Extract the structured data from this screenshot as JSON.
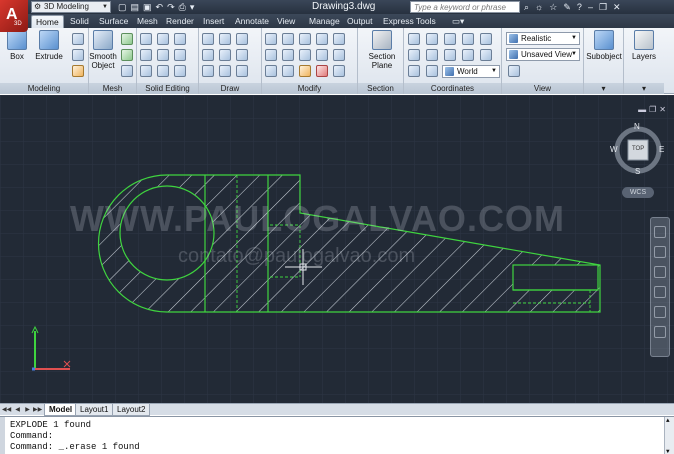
{
  "titlebar": {
    "workspace": "3D Modeling",
    "document_title": "Drawing3.dwg",
    "search_placeholder": "Type a keyword or phrase",
    "app_letter": "A",
    "app_sub": "3D"
  },
  "tabs": [
    {
      "label": "Home"
    },
    {
      "label": "Solid"
    },
    {
      "label": "Surface"
    },
    {
      "label": "Mesh"
    },
    {
      "label": "Render"
    },
    {
      "label": "Insert"
    },
    {
      "label": "Annotate"
    },
    {
      "label": "View"
    },
    {
      "label": "Manage"
    },
    {
      "label": "Output"
    },
    {
      "label": "Express Tools"
    }
  ],
  "ribbon": {
    "box_label": "Box",
    "extrude_label": "Extrude",
    "smooth_label_1": "Smooth",
    "smooth_label_2": "Object",
    "section_label_1": "Section",
    "section_label_2": "Plane",
    "visual_style": "Realistic",
    "view_name": "Unsaved View",
    "ucs_name": "World",
    "subobject_label": "Subobject",
    "layers_label": "Layers",
    "panels": {
      "modeling": "Modeling",
      "mesh": "Mesh",
      "solid_editing": "Solid Editing",
      "draw": "Draw",
      "modify": "Modify",
      "section": "Section",
      "coordinates": "Coordinates",
      "view": "View"
    }
  },
  "viewcube": {
    "north": "N",
    "south": "S",
    "east": "E",
    "west": "W",
    "face": "TOP",
    "wcs": "WCS"
  },
  "watermark": {
    "line1": "WWW.PAULOGALVAO.COM",
    "line2": "contato@paulogalvao.com"
  },
  "layout_tabs": [
    {
      "label": "Model",
      "active": true
    },
    {
      "label": "Layout1",
      "active": false
    },
    {
      "label": "Layout2",
      "active": false
    }
  ],
  "command_lines": [
    "EXPLODE 1 found",
    "Command:",
    "Command: _.erase 1 found"
  ],
  "colors": {
    "canvas_bg": "#222a36",
    "geometry": "#3fd43f",
    "hatch": "#c9d0d8"
  }
}
